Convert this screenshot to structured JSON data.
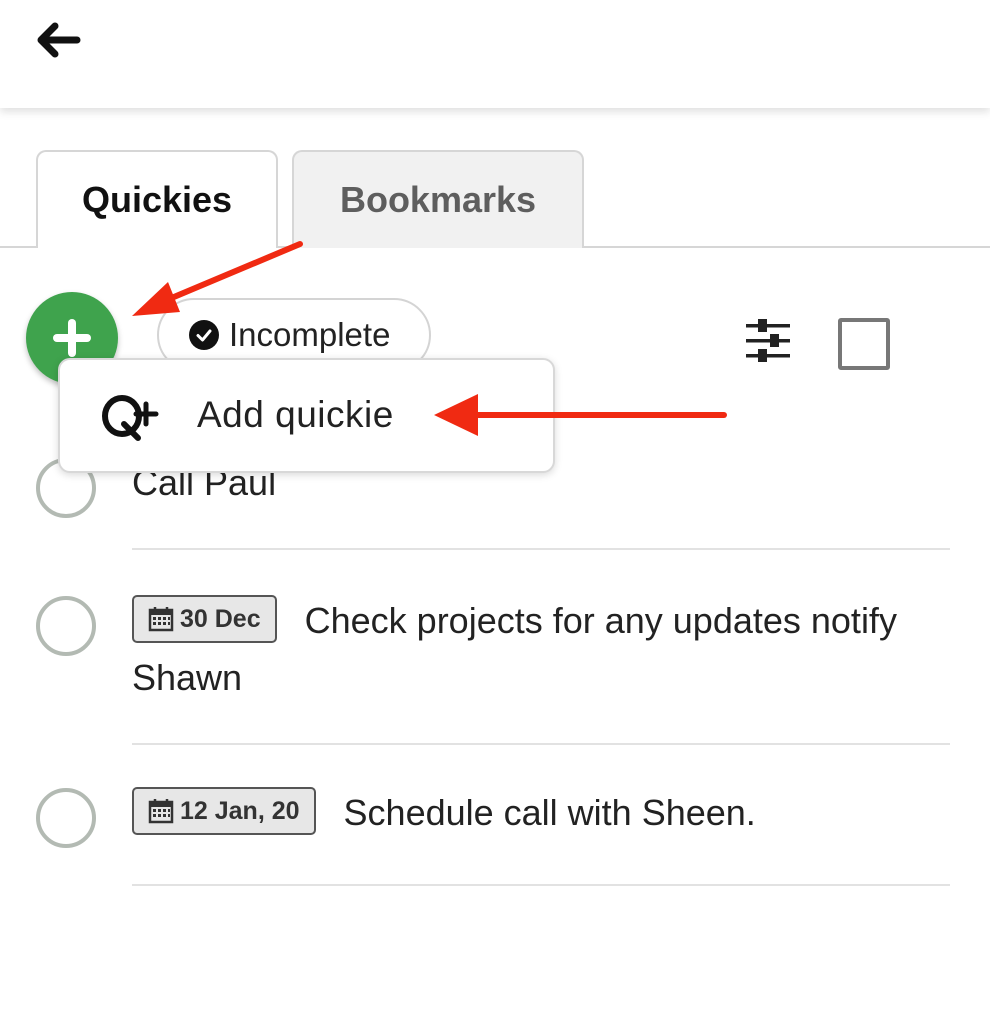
{
  "header": {
    "back_icon": "arrow-left-icon"
  },
  "tabs": [
    {
      "label": "Quickies",
      "active": true
    },
    {
      "label": "Bookmarks",
      "active": false
    }
  ],
  "toolbar": {
    "add_icon": "plus-icon",
    "filter_label": "Incomplete",
    "filter_icon": "check-circle-icon",
    "sliders_icon": "sliders-icon",
    "select_icon": "checkbox-icon"
  },
  "dropdown": {
    "icon": "q-plus-icon",
    "label": "Add quickie"
  },
  "tasks": [
    {
      "title": "Call Paul",
      "date": ""
    },
    {
      "title": "Check projects for any updates notify Shawn",
      "date": "30 Dec"
    },
    {
      "title": "Schedule call with Sheen.",
      "date": "12 Jan, 20"
    }
  ],
  "colors": {
    "fab": "#3fa34d",
    "annotation_arrow": "#f02a12"
  }
}
